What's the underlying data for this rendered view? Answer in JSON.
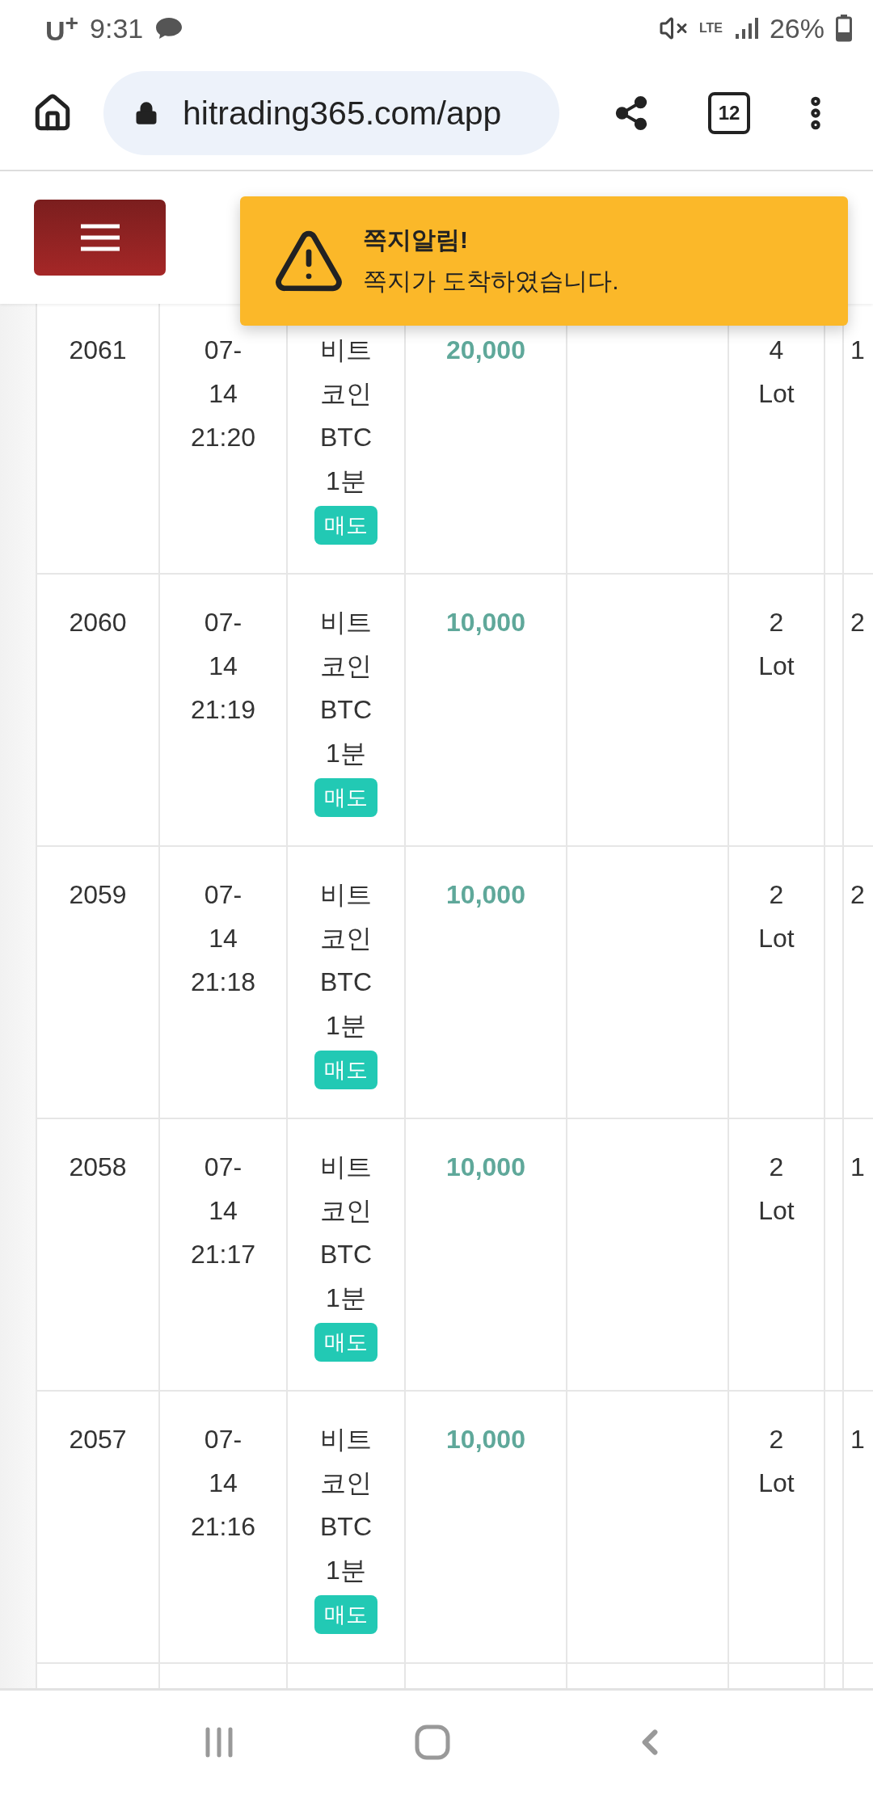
{
  "status_bar": {
    "carrier": "U$^{+}$",
    "time": "9:31",
    "network": "LTE",
    "battery": "26%"
  },
  "browser": {
    "url": "hitrading365.com/app",
    "tab_count": "12"
  },
  "toast": {
    "title": "쪽지알림!",
    "message": "쪽지가 도착하였습니다."
  },
  "table": {
    "rows": [
      {
        "number": "2061",
        "datetime": [
          "07-",
          "14",
          "21:20"
        ],
        "product": [
          "비트",
          "코인",
          "BTC",
          "1분"
        ],
        "side": "매도",
        "amount": "20,000",
        "lots": [
          "4",
          "Lot"
        ],
        "column_8": "1"
      },
      {
        "number": "2060",
        "datetime": [
          "07-",
          "14",
          "21:19"
        ],
        "product": [
          "비트",
          "코인",
          "BTC",
          "1분"
        ],
        "side": "매도",
        "amount": "10,000",
        "lots": [
          "2",
          "Lot"
        ],
        "column_8": "2"
      },
      {
        "number": "2059",
        "datetime": [
          "07-",
          "14",
          "21:18"
        ],
        "product": [
          "비트",
          "코인",
          "BTC",
          "1분"
        ],
        "side": "매도",
        "amount": "10,000",
        "lots": [
          "2",
          "Lot"
        ],
        "column_8": "2"
      },
      {
        "number": "2058",
        "datetime": [
          "07-",
          "14",
          "21:17"
        ],
        "product": [
          "비트",
          "코인",
          "BTC",
          "1분"
        ],
        "side": "매도",
        "amount": "10,000",
        "lots": [
          "2",
          "Lot"
        ],
        "column_8": "1"
      },
      {
        "number": "2057",
        "datetime": [
          "07-",
          "14",
          "21:16"
        ],
        "product": [
          "비트",
          "코인",
          "BTC",
          "1분"
        ],
        "side": "매도",
        "amount": "10,000",
        "lots": [
          "2",
          "Lot"
        ],
        "column_8": "1"
      }
    ]
  }
}
